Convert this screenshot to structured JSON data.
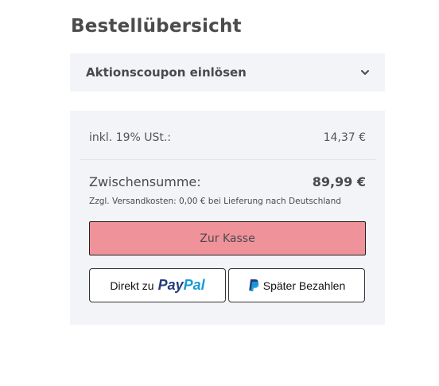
{
  "page_title": "Bestellübersicht",
  "coupon": {
    "label": "Aktionscoupon einlösen",
    "icon": "chevron-down-icon"
  },
  "summary": {
    "tax_label": "inkl. 19% USt.:",
    "tax_value": "14,37 €",
    "subtotal_label": "Zwischensumme:",
    "subtotal_value": "89,99 €",
    "shipping_note": "Zzgl. Versandkosten: 0,00 € bei Lieferung nach Deutschland"
  },
  "buttons": {
    "checkout_label": "Zur Kasse",
    "paypal_direct_prefix": "Direkt zu",
    "paypal_logo_pay": "Pay",
    "paypal_logo_pal": "Pal",
    "paypal_later_label": "Später Bezahlen"
  },
  "colors": {
    "checkout_bg": "#f0929a",
    "panel_bg": "#f3f4f8",
    "paypal_dark": "#253b80",
    "paypal_light": "#179bd7"
  }
}
